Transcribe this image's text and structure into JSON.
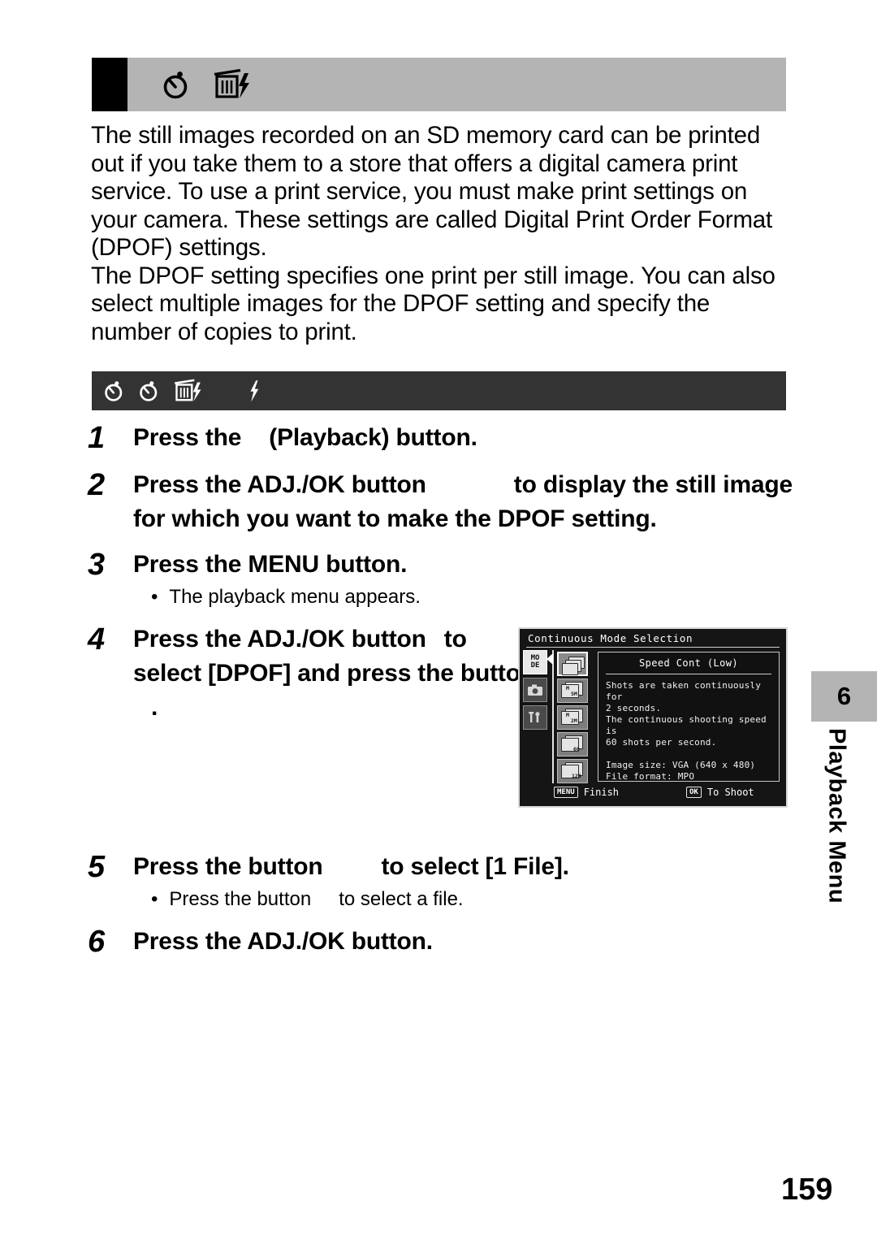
{
  "header": {
    "title_icons": [
      "self-timer-icon",
      "trash-flash-icon"
    ],
    "title_text": ""
  },
  "intro": {
    "paragraph_1": "The still images recorded on an SD memory card can be printed out if you take them to a store that offers a digital camera print service. To use a print service, you must make print settings on your camera. These settings are called Digital Print Order Format (DPOF) settings.",
    "paragraph_2": "The DPOF setting specifies one print per still image. You can also select multiple images for the DPOF setting and specify the number of copies to print."
  },
  "procedure_bar": {
    "icons": [
      "self-timer-icon",
      "self-timer-icon",
      "trash-flash-icon",
      "flash-icon"
    ],
    "title_text": ""
  },
  "steps": [
    {
      "number": "1",
      "text_before": "Press the",
      "text_after": "(Playback) button.",
      "note": null
    },
    {
      "number": "2",
      "text_before": "Press the ADJ./OK button",
      "text_after": "to display the still image for which you want to make the DPOF setting.",
      "note": null
    },
    {
      "number": "3",
      "text_before": "Press the MENU button.",
      "text_after": "",
      "note": "The playback menu appears."
    },
    {
      "number": "4",
      "text_before": "Press the ADJ./OK button",
      "text_after": "to select [DPOF] and press the",
      "text_after2": "button",
      "text_after3": ".",
      "note": null
    },
    {
      "number": "5",
      "text_before": "Press the button",
      "text_after": "to select [1 File].",
      "note_before": "Press the button",
      "note_after": "to select a file."
    },
    {
      "number": "6",
      "text_before": "Press the ADJ./OK button.",
      "text_after": "",
      "note": null
    }
  ],
  "bullet_char": "•",
  "lcd": {
    "title": "Continuous Mode Selection",
    "tabs": [
      {
        "name": "mode-tab",
        "label_line1": "MO",
        "label_line2": "DE",
        "selected": true
      },
      {
        "name": "shooting-tab",
        "label_line1": "",
        "label_line2": "",
        "selected": false
      },
      {
        "name": "setup-tab",
        "label_line1": "",
        "label_line2": "",
        "selected": false
      }
    ],
    "mode_icons": [
      {
        "label": "",
        "selected": true
      },
      {
        "label": "5M",
        "corner": "M",
        "selected": false
      },
      {
        "label": "2M",
        "corner": "M",
        "selected": false
      },
      {
        "label": "60",
        "corner": "",
        "selected": false
      },
      {
        "label": "120",
        "corner": "",
        "selected": false
      }
    ],
    "panel": {
      "title": "Speed Cont (Low)",
      "body": "Shots are taken continuously for\n2 seconds.\nThe continuous shooting speed is\n60 shots per second.\n\nImage size: VGA (640 x 480)\nFile format: MPO"
    },
    "bottom": {
      "left_badge": "MENU",
      "left_label": "Finish",
      "right_badge": "OK",
      "right_label": "To Shoot"
    }
  },
  "chapter": {
    "number": "6",
    "label": "Playback Menu"
  },
  "page_number": "159",
  "colors": {
    "header_gray": "#b4b4b4",
    "proc_bar_dark": "#333333",
    "lcd_background": "#151515",
    "text": "#000000"
  }
}
